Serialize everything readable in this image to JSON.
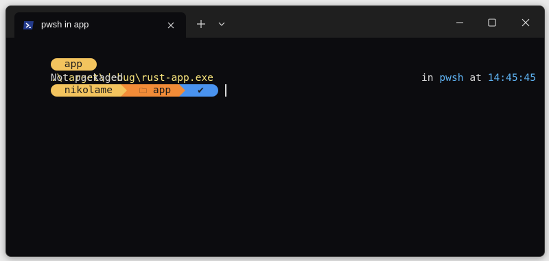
{
  "window": {
    "tab_title": "pwsh in app",
    "new_tab_label": "+",
    "tab_dropdown_label": "⌄"
  },
  "terminal": {
    "line1": {
      "prompt_segment": "app",
      "command": ".\\target\\debug\\rust-app.exe"
    },
    "line2": {
      "output": "Not packaged"
    },
    "line3": {
      "user_segment": "nikolame",
      "folder_icon": "🗀",
      "path_segment": "app",
      "status_segment": "✔",
      "right_prompt": {
        "in_label": "in",
        "shell": "pwsh",
        "at_label": "at",
        "time": "14:45:45"
      }
    }
  },
  "colors": {
    "segment_yellow": "#f3c45e",
    "segment_orange": "#f28c38",
    "segment_blue": "#4a93ef",
    "command_text": "#f6e27a",
    "accent_blue": "#5fb3f3"
  },
  "icons": {
    "tab": "powershell-icon",
    "close": "close-icon",
    "minimize": "minimize-icon",
    "maximize": "maximize-icon",
    "window_close": "window-close-icon"
  }
}
